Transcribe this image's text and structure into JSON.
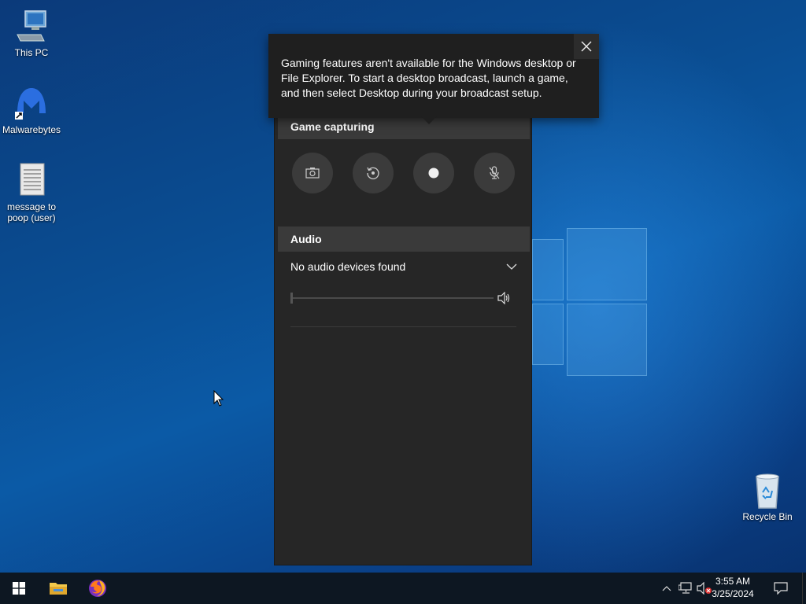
{
  "desktop": {
    "icons": [
      {
        "label": "This PC",
        "icon": "computer-icon"
      },
      {
        "label": "Malwarebytes",
        "icon": "malwarebytes-icon"
      },
      {
        "label": "message to poop (user)",
        "icon": "text-file-icon"
      },
      {
        "label": "Recycle Bin",
        "icon": "recycle-bin-icon"
      }
    ]
  },
  "tooltip": {
    "text": "Gaming features aren't available for the Windows desktop or File Explorer. To start a desktop broadcast, launch a game, and then select Desktop during your broadcast setup.",
    "close_icon": "close-icon"
  },
  "gamebar": {
    "capture_header": "Game capturing",
    "capture_buttons": [
      {
        "icon": "camera-icon"
      },
      {
        "icon": "record-last-icon"
      },
      {
        "icon": "record-dot-icon"
      },
      {
        "icon": "mic-off-icon"
      }
    ],
    "audio_header": "Audio",
    "audio_device": "No audio devices found",
    "volume_level": 0
  },
  "taskbar": {
    "time": "3:55 AM",
    "date": "3/25/2024",
    "apps": [
      {
        "icon": "windows-start-icon"
      },
      {
        "icon": "file-explorer-icon"
      },
      {
        "icon": "firefox-icon"
      }
    ],
    "tray": [
      {
        "icon": "chevron-up-icon"
      },
      {
        "icon": "network-icon"
      },
      {
        "icon": "volume-muted-icon"
      },
      {
        "icon": "notification-icon"
      }
    ]
  },
  "colors": {
    "panel_bg": "#262626",
    "header_bg": "#3a3a3a",
    "taskbar_bg": "#0d1722"
  }
}
